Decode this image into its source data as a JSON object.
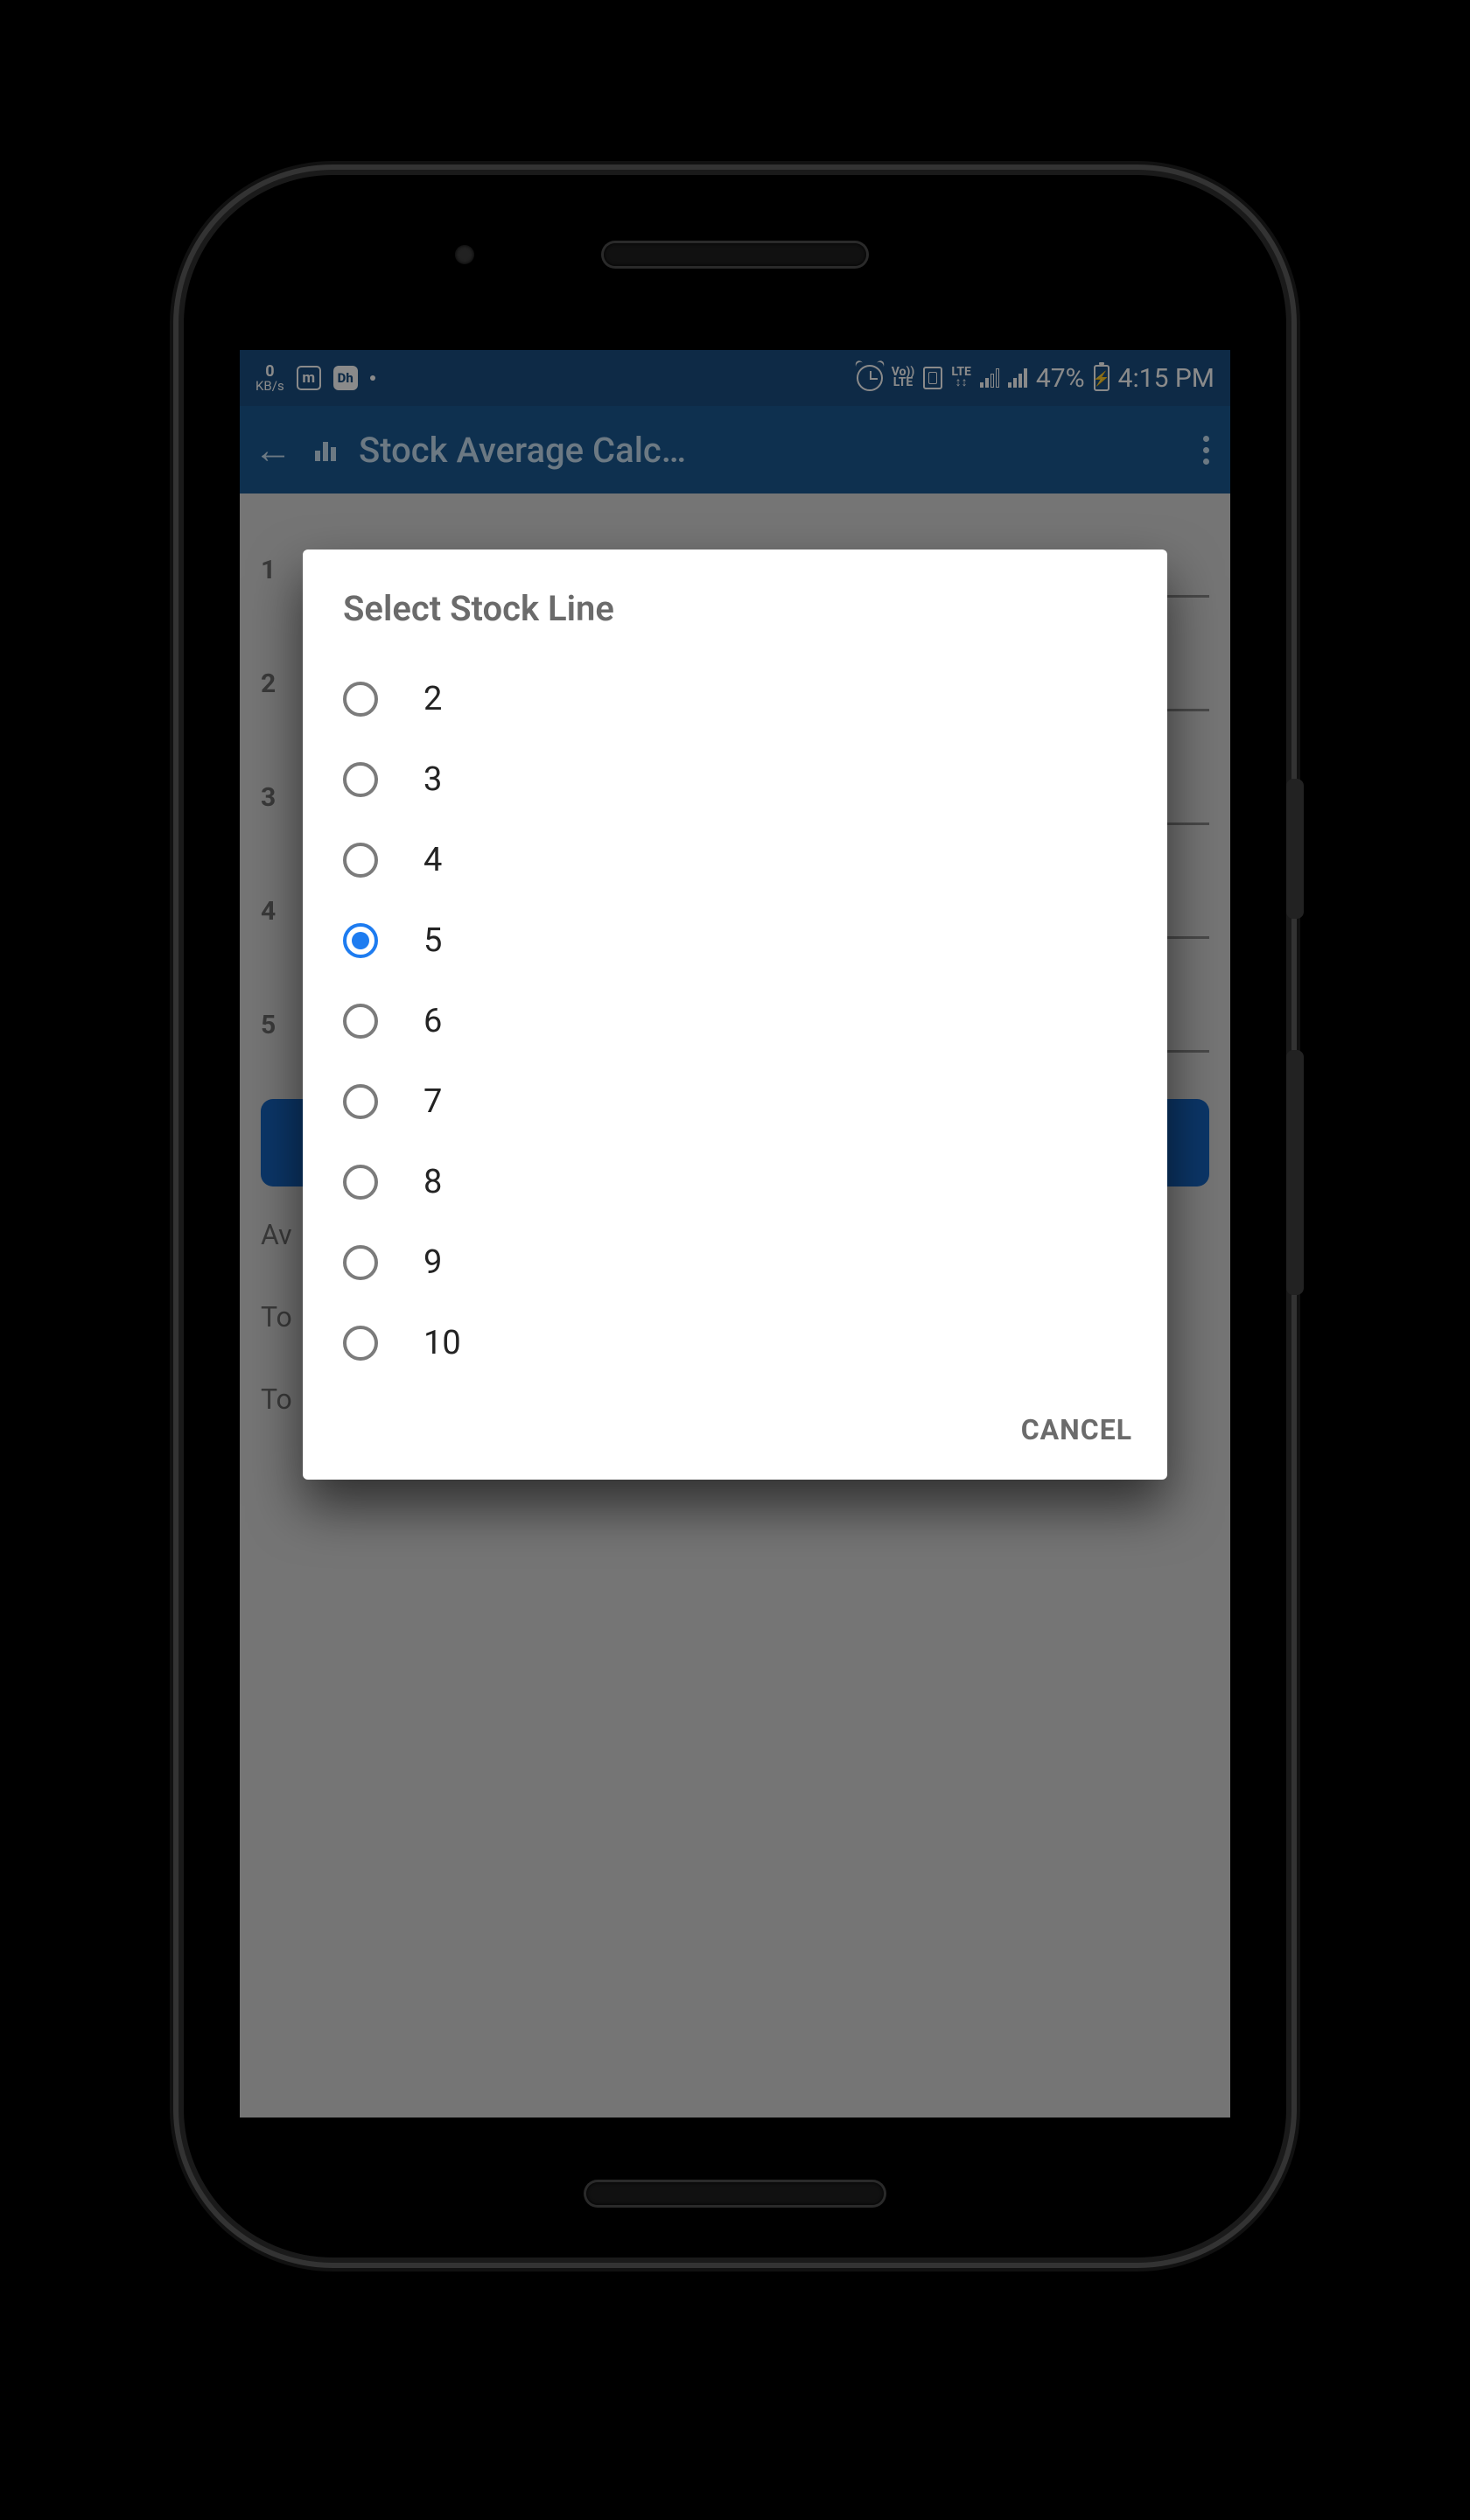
{
  "status": {
    "kbps_value": "0",
    "kbps_unit": "KB/s",
    "m_icon": "m",
    "dh_icon": "Dh",
    "volte_top": "Vo))",
    "volte_bot": "LTE",
    "lte2_top": "LTE",
    "lte2_bot": "↕↕",
    "battery_pct": "47%",
    "time": "4:15 PM"
  },
  "appbar": {
    "title": "Stock Average Calc…"
  },
  "background": {
    "rows": [
      "1",
      "2",
      "3",
      "4",
      "5"
    ],
    "results": [
      "Av",
      "To",
      "To"
    ]
  },
  "dialog": {
    "title": "Select Stock Line",
    "options": [
      {
        "label": "2",
        "selected": false
      },
      {
        "label": "3",
        "selected": false
      },
      {
        "label": "4",
        "selected": false
      },
      {
        "label": "5",
        "selected": true
      },
      {
        "label": "6",
        "selected": false
      },
      {
        "label": "7",
        "selected": false
      },
      {
        "label": "8",
        "selected": false
      },
      {
        "label": "9",
        "selected": false
      },
      {
        "label": "10",
        "selected": false
      }
    ],
    "cancel": "CANCEL"
  }
}
